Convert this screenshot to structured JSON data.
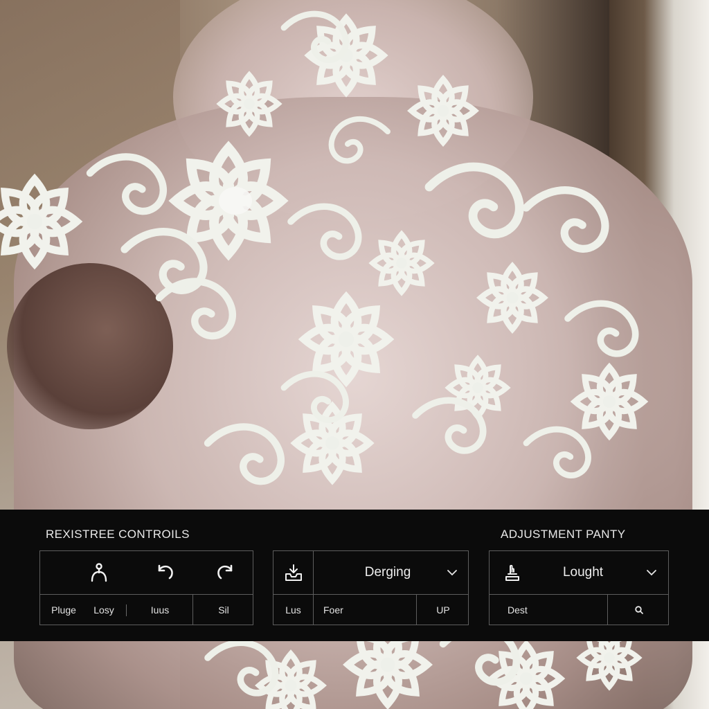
{
  "controls_section": {
    "title": "REXISTREE CONTROILS",
    "buttons": [
      {
        "icon": "hook-person-icon"
      },
      {
        "icon": "undo-icon"
      },
      {
        "icon": "redo-icon"
      }
    ],
    "labels": [
      "Pluge",
      "Losy",
      "Iuus",
      "Sil"
    ]
  },
  "middle_panel": {
    "icon": "download-tray-icon",
    "dropdown_value": "Derging",
    "labels": [
      "Lus",
      "Foer",
      "UP"
    ]
  },
  "adjustment_section": {
    "title": "ADJUSTMENT PANTY",
    "icon": "hand-touch-icon",
    "dropdown_value": "Lought",
    "search_label": "Dest"
  },
  "colors": {
    "overlay_background": "#0b0b0b",
    "panel_border": "#5e5e5e",
    "text": "#e9e9e9"
  }
}
